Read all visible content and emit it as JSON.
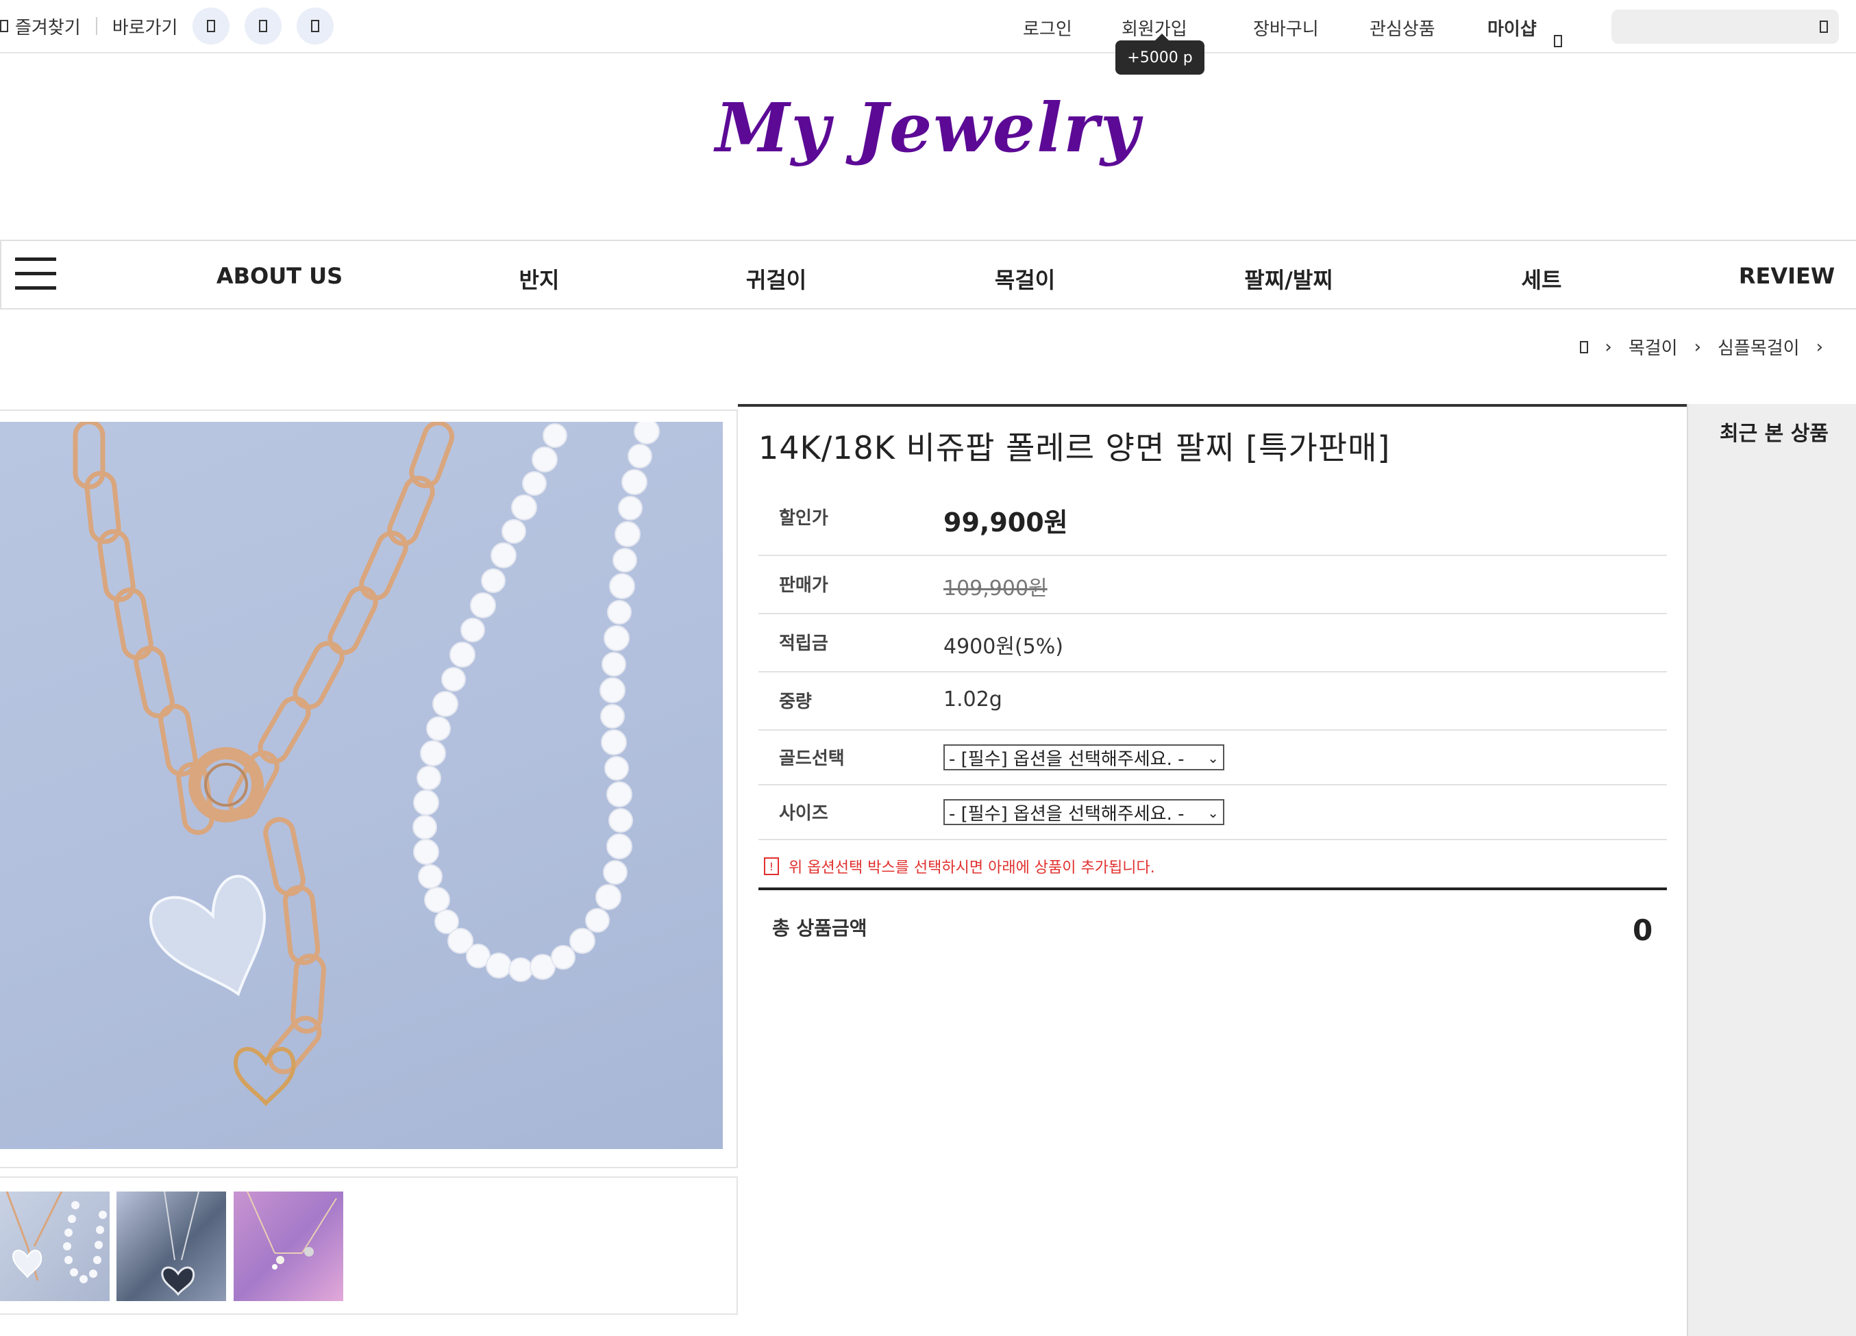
{
  "topbar": {
    "bookmark": "즐겨찾기",
    "shortcut": "바로가기",
    "social_icons": [
      "share-icon",
      "share-icon",
      "share-icon"
    ],
    "login": "로그인",
    "join": "회원가입",
    "join_tooltip": "+5000 p",
    "cart": "장바구니",
    "wishlist": "관심상품",
    "myshop": "마이샵",
    "search_placeholder": ""
  },
  "logo": "My Jewelry",
  "nav": {
    "items": [
      "ABOUT US",
      "반지",
      "귀걸이",
      "목걸이",
      "팔찌/발찌",
      "세트",
      "REVIEW"
    ]
  },
  "breadcrumb": [
    "목걸이",
    "심플목걸이"
  ],
  "product": {
    "title": "14K/18K 비쥬팝 폴레르 양면 팔찌 [특가판매]",
    "rows": [
      {
        "label": "할인가",
        "value": "99,900원"
      },
      {
        "label": "판매가",
        "value": "109,900원"
      },
      {
        "label": "적립금",
        "value": "4900원(5%)"
      },
      {
        "label": "중량",
        "value": "1.02g"
      }
    ],
    "options": [
      {
        "label": "골드선택",
        "selected": "- [필수] 옵션을 선택해주세요. -"
      },
      {
        "label": "사이즈",
        "selected": "- [필수] 옵션을 선택해주세요. -"
      }
    ],
    "notice": "위 옵션선택 박스를 선택하시면 아래에 상품이 추가됩니다.",
    "total_label": "총 상품금액",
    "total_value": "0"
  },
  "recent": {
    "title": "최근 본 상품"
  },
  "colors": {
    "logo": "#5c0a96",
    "notice": "#e0302e",
    "tooltip_bg": "#2a2a2a"
  }
}
